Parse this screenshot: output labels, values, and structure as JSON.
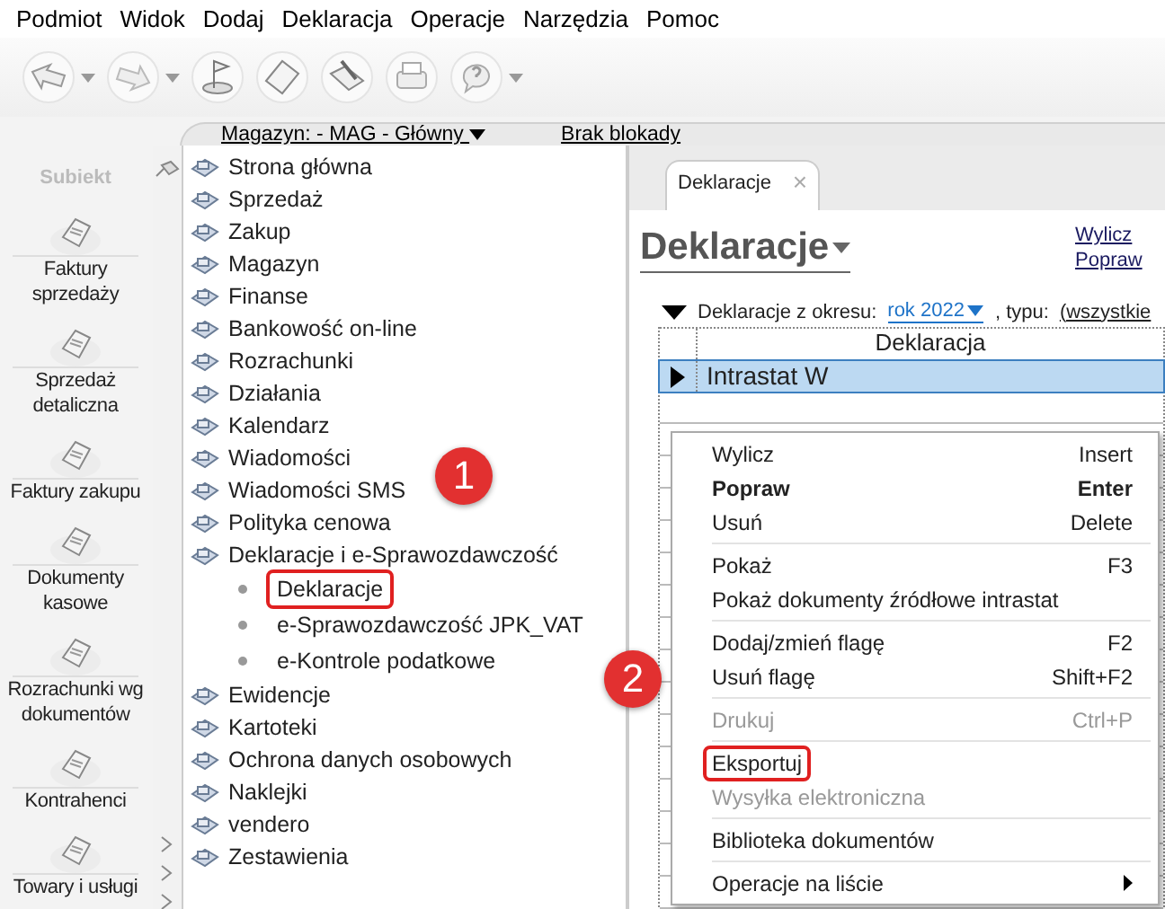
{
  "menu_bar": [
    "Podmiot",
    "Widok",
    "Dodaj",
    "Deklaracja",
    "Operacje",
    "Narzędzia",
    "Pomoc"
  ],
  "toolbar": [
    {
      "kind": "arrow-left",
      "dropdown": true
    },
    {
      "kind": "arrow-right",
      "dropdown": true
    },
    {
      "kind": "flag",
      "dropdown": false
    },
    {
      "kind": "paper",
      "dropdown": false
    },
    {
      "kind": "pen",
      "dropdown": false
    },
    {
      "kind": "printer",
      "dropdown": false
    },
    {
      "kind": "help",
      "dropdown": true
    }
  ],
  "logo": {
    "text": "Subiekt"
  },
  "sidebar": [
    {
      "label": "Faktury sprzedaży"
    },
    {
      "label": "Sprzedaż detaliczna"
    },
    {
      "label": "Faktury zakupu"
    },
    {
      "label": "Dokumenty kasowe"
    },
    {
      "label": "Rozrachunki wg dokumentów"
    },
    {
      "label": "Kontrahenci"
    },
    {
      "label": "Towary i usługi"
    }
  ],
  "header": {
    "warehouse": "Magazyn: - MAG - Główny",
    "lock": "Brak blokady"
  },
  "tree": [
    {
      "label": "Strona główna"
    },
    {
      "label": "Sprzedaż"
    },
    {
      "label": "Zakup"
    },
    {
      "label": "Magazyn"
    },
    {
      "label": "Finanse"
    },
    {
      "label": "Bankowość on-line"
    },
    {
      "label": "Rozrachunki"
    },
    {
      "label": "Działania"
    },
    {
      "label": "Kalendarz"
    },
    {
      "label": "Wiadomości"
    },
    {
      "label": "Wiadomości SMS"
    },
    {
      "label": "Polityka cenowa"
    },
    {
      "label": "Deklaracje i e-Sprawozdawczość",
      "children": [
        {
          "label": "Deklaracje",
          "highlighted": true
        },
        {
          "label": "e-Sprawozdawczość JPK_VAT",
          "highlighted": false
        },
        {
          "label": "e-Kontrole podatkowe",
          "highlighted": false
        }
      ]
    },
    {
      "label": "Ewidencje"
    },
    {
      "label": "Kartoteki"
    },
    {
      "label": "Ochrona danych osobowych"
    },
    {
      "label": "Naklejki"
    },
    {
      "label": "vendero"
    },
    {
      "label": "Zestawienia"
    }
  ],
  "tabs": [
    {
      "label": "Deklaracje",
      "selected": true,
      "close": "×"
    }
  ],
  "page_title": "Deklaracje",
  "actions": [
    "Wylicz",
    "Popraw"
  ],
  "filter": {
    "label": "Deklaracje z okresu:",
    "period": "rok 2022",
    "type_label": ", typu:",
    "type": "(wszystkie"
  },
  "table": {
    "columns": [
      "Deklaracja"
    ],
    "rows": [
      {
        "name": "Intrastat W",
        "selected": true
      }
    ]
  },
  "context_menu": [
    {
      "kind": "item",
      "label": "Wylicz",
      "shortcut": "Insert",
      "bold": false,
      "disabled": false,
      "highlighted": false
    },
    {
      "kind": "item",
      "label": "Popraw",
      "shortcut": "Enter",
      "bold": true,
      "disabled": false,
      "highlighted": false
    },
    {
      "kind": "item",
      "label": "Usuń",
      "shortcut": "Delete",
      "bold": false,
      "disabled": false,
      "highlighted": false
    },
    {
      "kind": "separator"
    },
    {
      "kind": "item",
      "label": "Pokaż",
      "shortcut": "F3",
      "bold": false,
      "disabled": false,
      "highlighted": false
    },
    {
      "kind": "item",
      "label": "Pokaż dokumenty źródłowe intrastat",
      "bold": false,
      "disabled": false,
      "highlighted": false
    },
    {
      "kind": "separator"
    },
    {
      "kind": "item",
      "label": "Dodaj/zmień flagę",
      "shortcut": "F2",
      "bold": false,
      "disabled": false,
      "highlighted": false
    },
    {
      "kind": "item",
      "label": "Usuń flagę",
      "shortcut": "Shift+F2",
      "bold": false,
      "disabled": false,
      "highlighted": false
    },
    {
      "kind": "separator"
    },
    {
      "kind": "item",
      "label": "Drukuj",
      "shortcut": "Ctrl+P",
      "bold": false,
      "disabled": true,
      "highlighted": false
    },
    {
      "kind": "separator"
    },
    {
      "kind": "item",
      "label": "Eksportuj",
      "bold": false,
      "disabled": false,
      "highlighted": true
    },
    {
      "kind": "item",
      "label": "Wysyłka elektroniczna",
      "bold": false,
      "disabled": true,
      "highlighted": false
    },
    {
      "kind": "separator"
    },
    {
      "kind": "item",
      "label": "Biblioteka dokumentów",
      "bold": false,
      "disabled": false,
      "highlighted": false
    },
    {
      "kind": "separator"
    },
    {
      "kind": "item",
      "label": "Operacje na liście",
      "bold": false,
      "disabled": false,
      "highlighted": false,
      "submenu": true
    }
  ],
  "annotations": [
    {
      "number": "1"
    },
    {
      "number": "2"
    }
  ]
}
